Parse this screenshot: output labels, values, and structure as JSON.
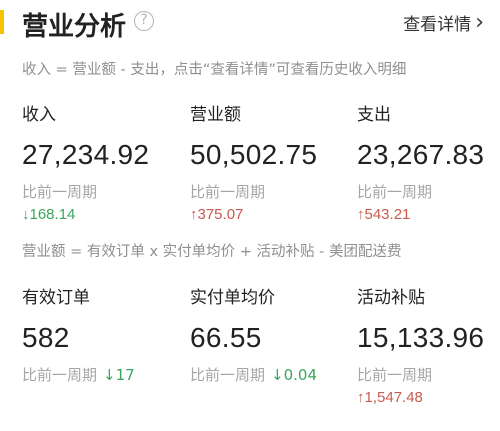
{
  "header": {
    "title": "营业分析",
    "help_glyph": "?",
    "detail_label": "查看详情",
    "chevron": "›",
    "accent_color": "#f5c400"
  },
  "notes": {
    "formula1": "收入 = 营业额 - 支出，点击“查看详情”可查看历史收入明细",
    "formula2": "营业额 = 有效订单 x 实付单均价 + 活动补贴 - 美团配送费"
  },
  "compare_label": "比前一周期",
  "metrics": [
    {
      "label": "收入",
      "value": "27,234.92",
      "delta": "↓168.14",
      "trend": "down"
    },
    {
      "label": "营业额",
      "value": "50,502.75",
      "delta": "↑375.07",
      "trend": "up"
    },
    {
      "label": "支出",
      "value": "23,267.83",
      "delta": "↑543.21",
      "trend": "up"
    },
    {
      "label": "有效订单",
      "value": "582",
      "delta": "↓17",
      "trend": "down"
    },
    {
      "label": "实付单均价",
      "value": "66.55",
      "delta": "↓0.04",
      "trend": "down"
    },
    {
      "label": "活动补贴",
      "value": "15,133.96",
      "delta": "↑1,547.48",
      "trend": "up"
    }
  ],
  "colors": {
    "down": "#3ba55c",
    "up": "#c85b4f",
    "muted": "#8f8f8f"
  }
}
